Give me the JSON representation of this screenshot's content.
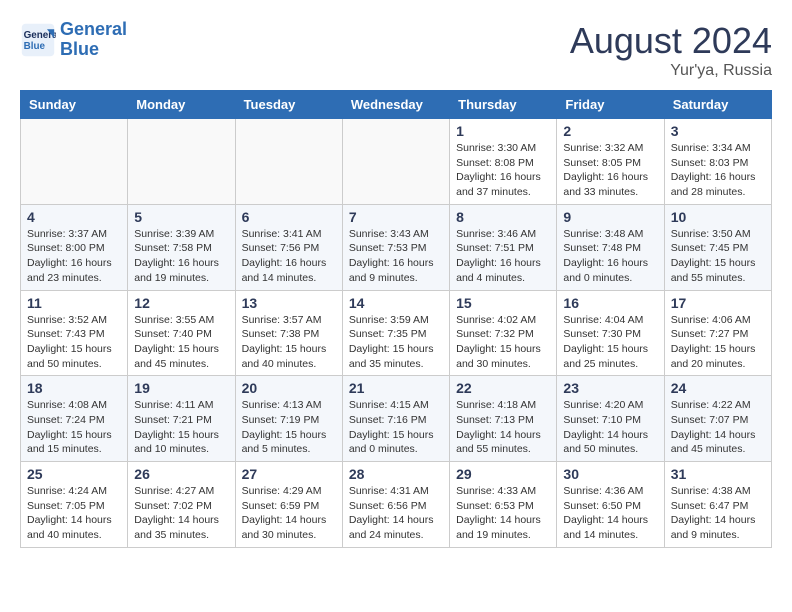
{
  "logo": {
    "line1": "General",
    "line2": "Blue"
  },
  "title": "August 2024",
  "location": "Yur'ya, Russia",
  "days_header": [
    "Sunday",
    "Monday",
    "Tuesday",
    "Wednesday",
    "Thursday",
    "Friday",
    "Saturday"
  ],
  "weeks": [
    [
      {
        "day": "",
        "info": ""
      },
      {
        "day": "",
        "info": ""
      },
      {
        "day": "",
        "info": ""
      },
      {
        "day": "",
        "info": ""
      },
      {
        "day": "1",
        "info": "Sunrise: 3:30 AM\nSunset: 8:08 PM\nDaylight: 16 hours\nand 37 minutes."
      },
      {
        "day": "2",
        "info": "Sunrise: 3:32 AM\nSunset: 8:05 PM\nDaylight: 16 hours\nand 33 minutes."
      },
      {
        "day": "3",
        "info": "Sunrise: 3:34 AM\nSunset: 8:03 PM\nDaylight: 16 hours\nand 28 minutes."
      }
    ],
    [
      {
        "day": "4",
        "info": "Sunrise: 3:37 AM\nSunset: 8:00 PM\nDaylight: 16 hours\nand 23 minutes."
      },
      {
        "day": "5",
        "info": "Sunrise: 3:39 AM\nSunset: 7:58 PM\nDaylight: 16 hours\nand 19 minutes."
      },
      {
        "day": "6",
        "info": "Sunrise: 3:41 AM\nSunset: 7:56 PM\nDaylight: 16 hours\nand 14 minutes."
      },
      {
        "day": "7",
        "info": "Sunrise: 3:43 AM\nSunset: 7:53 PM\nDaylight: 16 hours\nand 9 minutes."
      },
      {
        "day": "8",
        "info": "Sunrise: 3:46 AM\nSunset: 7:51 PM\nDaylight: 16 hours\nand 4 minutes."
      },
      {
        "day": "9",
        "info": "Sunrise: 3:48 AM\nSunset: 7:48 PM\nDaylight: 16 hours\nand 0 minutes."
      },
      {
        "day": "10",
        "info": "Sunrise: 3:50 AM\nSunset: 7:45 PM\nDaylight: 15 hours\nand 55 minutes."
      }
    ],
    [
      {
        "day": "11",
        "info": "Sunrise: 3:52 AM\nSunset: 7:43 PM\nDaylight: 15 hours\nand 50 minutes."
      },
      {
        "day": "12",
        "info": "Sunrise: 3:55 AM\nSunset: 7:40 PM\nDaylight: 15 hours\nand 45 minutes."
      },
      {
        "day": "13",
        "info": "Sunrise: 3:57 AM\nSunset: 7:38 PM\nDaylight: 15 hours\nand 40 minutes."
      },
      {
        "day": "14",
        "info": "Sunrise: 3:59 AM\nSunset: 7:35 PM\nDaylight: 15 hours\nand 35 minutes."
      },
      {
        "day": "15",
        "info": "Sunrise: 4:02 AM\nSunset: 7:32 PM\nDaylight: 15 hours\nand 30 minutes."
      },
      {
        "day": "16",
        "info": "Sunrise: 4:04 AM\nSunset: 7:30 PM\nDaylight: 15 hours\nand 25 minutes."
      },
      {
        "day": "17",
        "info": "Sunrise: 4:06 AM\nSunset: 7:27 PM\nDaylight: 15 hours\nand 20 minutes."
      }
    ],
    [
      {
        "day": "18",
        "info": "Sunrise: 4:08 AM\nSunset: 7:24 PM\nDaylight: 15 hours\nand 15 minutes."
      },
      {
        "day": "19",
        "info": "Sunrise: 4:11 AM\nSunset: 7:21 PM\nDaylight: 15 hours\nand 10 minutes."
      },
      {
        "day": "20",
        "info": "Sunrise: 4:13 AM\nSunset: 7:19 PM\nDaylight: 15 hours\nand 5 minutes."
      },
      {
        "day": "21",
        "info": "Sunrise: 4:15 AM\nSunset: 7:16 PM\nDaylight: 15 hours\nand 0 minutes."
      },
      {
        "day": "22",
        "info": "Sunrise: 4:18 AM\nSunset: 7:13 PM\nDaylight: 14 hours\nand 55 minutes."
      },
      {
        "day": "23",
        "info": "Sunrise: 4:20 AM\nSunset: 7:10 PM\nDaylight: 14 hours\nand 50 minutes."
      },
      {
        "day": "24",
        "info": "Sunrise: 4:22 AM\nSunset: 7:07 PM\nDaylight: 14 hours\nand 45 minutes."
      }
    ],
    [
      {
        "day": "25",
        "info": "Sunrise: 4:24 AM\nSunset: 7:05 PM\nDaylight: 14 hours\nand 40 minutes."
      },
      {
        "day": "26",
        "info": "Sunrise: 4:27 AM\nSunset: 7:02 PM\nDaylight: 14 hours\nand 35 minutes."
      },
      {
        "day": "27",
        "info": "Sunrise: 4:29 AM\nSunset: 6:59 PM\nDaylight: 14 hours\nand 30 minutes."
      },
      {
        "day": "28",
        "info": "Sunrise: 4:31 AM\nSunset: 6:56 PM\nDaylight: 14 hours\nand 24 minutes."
      },
      {
        "day": "29",
        "info": "Sunrise: 4:33 AM\nSunset: 6:53 PM\nDaylight: 14 hours\nand 19 minutes."
      },
      {
        "day": "30",
        "info": "Sunrise: 4:36 AM\nSunset: 6:50 PM\nDaylight: 14 hours\nand 14 minutes."
      },
      {
        "day": "31",
        "info": "Sunrise: 4:38 AM\nSunset: 6:47 PM\nDaylight: 14 hours\nand 9 minutes."
      }
    ]
  ]
}
